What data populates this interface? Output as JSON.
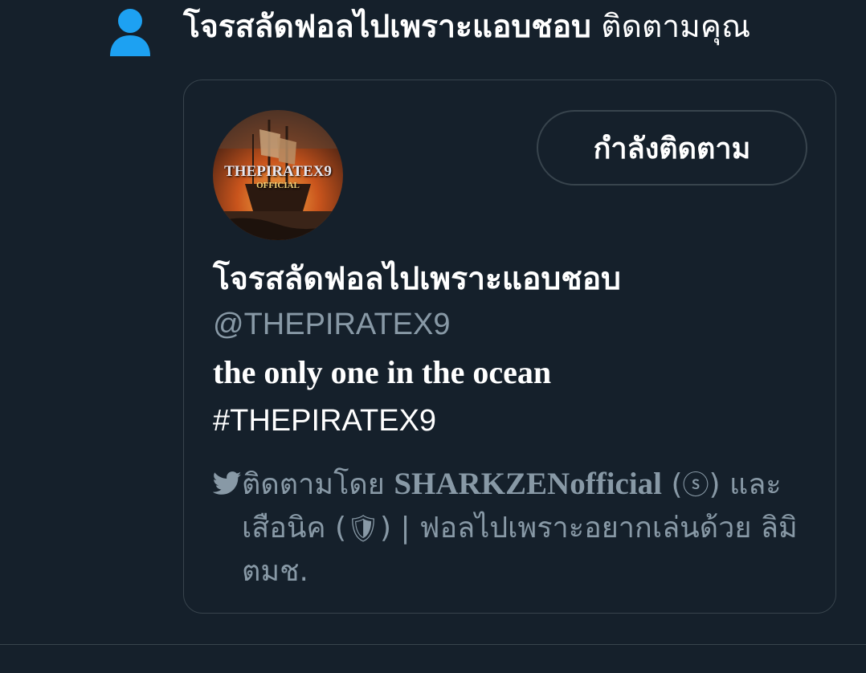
{
  "notification": {
    "follower_name": "โจรสลัดฟอลไปเพราะแอบชอบ",
    "action_text": "ติดตามคุณ",
    "icon": "person-icon",
    "accent_color": "#1da1f2"
  },
  "card": {
    "avatar": {
      "icon": "pirate-ship-avatar",
      "logo_text": "THEPIRATEX9",
      "logo_subtext": "OFFICIAL"
    },
    "follow_button_label": "กำลังติดตาม",
    "display_name": "โจรสลัดฟอลไปเพราะแอบชอบ",
    "handle": "@THEPIRATEX9",
    "bio_line1": "the only one in the ocean",
    "bio_line2": "#THEPIRATEX9",
    "followed_by": {
      "icon": "twitter-bird-icon",
      "prefix": "ติดตามโดย",
      "mention": "SHARKZENofficial",
      "mention_suffix": "(",
      "mention_emblem": "ⓢ",
      "mention_close": ")",
      "connector": "และ เสือนิค (",
      "second_emblem": "🛡",
      "rest": ") | ฟอลไปเพราะอยากเล่นด้วย ลิมิตมช."
    }
  },
  "colors": {
    "background": "#15202b",
    "border": "#38444d",
    "secondary_text": "#8899a6"
  }
}
